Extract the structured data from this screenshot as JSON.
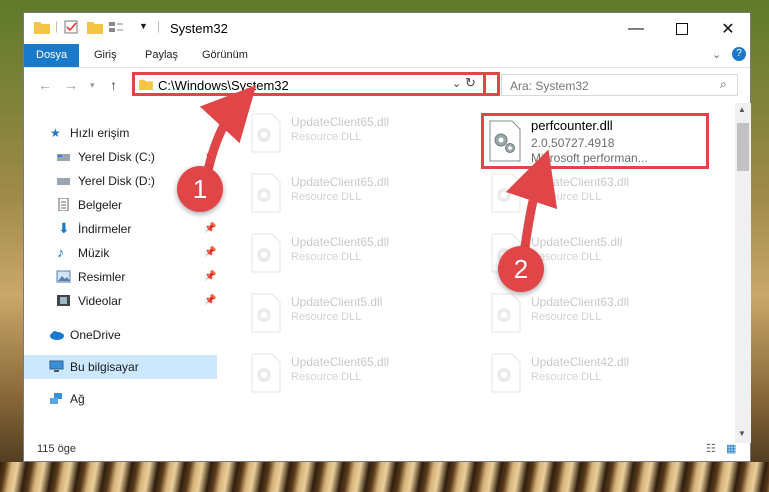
{
  "window": {
    "title": "System32",
    "controls": [
      "minimize",
      "maximize",
      "close"
    ]
  },
  "ribbon": {
    "tabs": [
      "Dosya",
      "Giriş",
      "Paylaş",
      "Görünüm"
    ]
  },
  "nav": {
    "address": "C:\\Windows\\System32",
    "search_placeholder": "Ara: System32"
  },
  "sidebar": {
    "items": [
      {
        "label": "Hızlı erişim",
        "icon": "star-icon"
      },
      {
        "label": "Yerel Disk (C:)",
        "icon": "drive-icon"
      },
      {
        "label": "Yerel Disk (D:)",
        "icon": "drive-icon"
      },
      {
        "label": "Belgeler",
        "icon": "document-icon"
      },
      {
        "label": "İndirmeler",
        "icon": "download-icon"
      },
      {
        "label": "Müzik",
        "icon": "music-icon"
      },
      {
        "label": "Resimler",
        "icon": "pictures-icon"
      },
      {
        "label": "Videolar",
        "icon": "video-icon"
      },
      {
        "label": "OneDrive",
        "icon": "cloud-icon"
      },
      {
        "label": "Bu bilgisayar",
        "icon": "computer-icon"
      },
      {
        "label": "Ağ",
        "icon": "network-icon"
      }
    ]
  },
  "files": {
    "featured": {
      "name": "perfcounter.dll",
      "version": "2.0.50727.4918",
      "description": "Microsoft performan..."
    },
    "faded": [
      {
        "name": "UpdateClient65.dll",
        "type": "Resource DLL"
      },
      {
        "name": "UpdateClient65.dll",
        "type": "Resource DLL"
      },
      {
        "name": "UpdateClient63.dll",
        "type": "Resource DLL"
      },
      {
        "name": "UpdateClient65.dll",
        "type": "Resource DLL"
      },
      {
        "name": "UpdateClient5.dll",
        "type": "Resource DLL"
      },
      {
        "name": "UpdateClient5.dll",
        "type": "Resource DLL"
      },
      {
        "name": "UpdateClient63.dll",
        "type": "Resource DLL"
      },
      {
        "name": "UpdateClient65.dll",
        "type": "Resource DLL"
      },
      {
        "name": "UpdateClient42.dll",
        "type": "Resource DLL"
      }
    ]
  },
  "status": {
    "item_count": "115 öge"
  },
  "callouts": [
    "1",
    "2"
  ],
  "colors": {
    "accent": "#1979ca",
    "highlight": "#e04548",
    "selection": "#cce8ff"
  }
}
